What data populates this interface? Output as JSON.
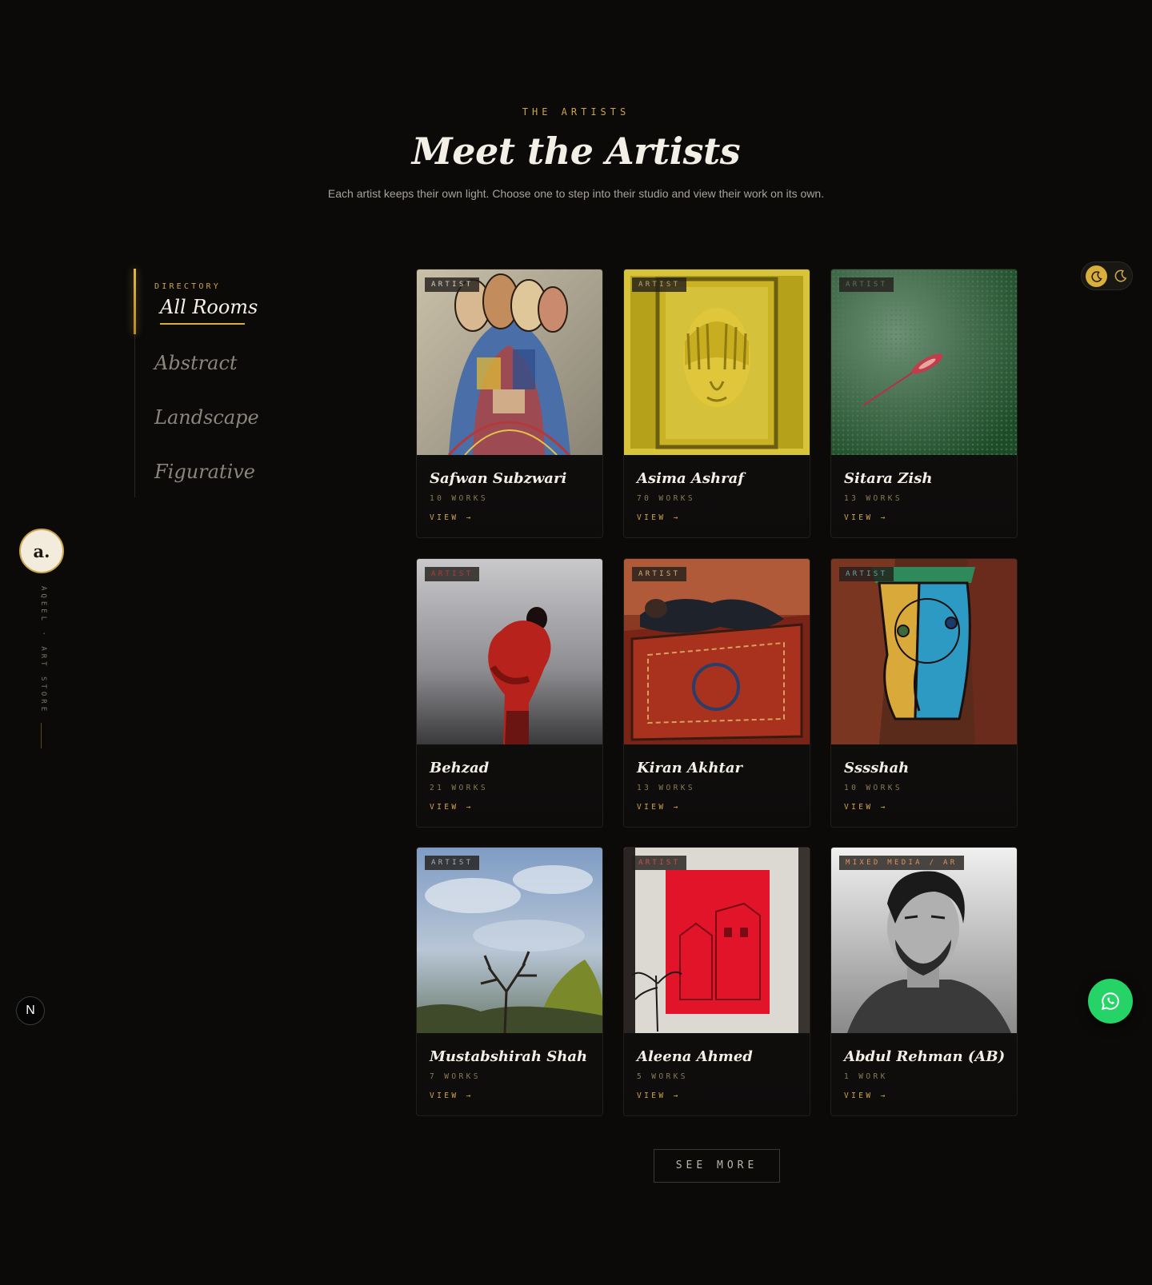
{
  "header": {
    "eyebrow": "THE ARTISTS",
    "title": "Meet the Artists",
    "subtitle": "Each artist keeps their own light. Choose one to step into their studio and view their work on its own."
  },
  "sidebar": {
    "label": "DIRECTORY",
    "items": [
      {
        "label": "All Rooms",
        "active": true
      },
      {
        "label": "Abstract",
        "active": false
      },
      {
        "label": "Landscape",
        "active": false
      },
      {
        "label": "Figurative",
        "active": false
      }
    ]
  },
  "artists": [
    {
      "badge": "ARTIST",
      "badge_color": "#d8cfbf",
      "name": "Safwan Subzwari",
      "works": "10 WORKS",
      "view": "VIEW →"
    },
    {
      "badge": "ARTIST",
      "badge_color": "#b9a873",
      "name": "Asima Ashraf",
      "works": "70 WORKS",
      "view": "VIEW →"
    },
    {
      "badge": "ARTIST",
      "badge_color": "#5f6e60",
      "name": "Sitara Zish",
      "works": "13 WORKS",
      "view": "VIEW →"
    },
    {
      "badge": "ARTIST",
      "badge_color": "#b03a3a",
      "name": "Behzad",
      "works": "21 WORKS",
      "view": "VIEW →"
    },
    {
      "badge": "ARTIST",
      "badge_color": "#d4b07a",
      "name": "Kiran Akhtar",
      "works": "13 WORKS",
      "view": "VIEW →"
    },
    {
      "badge": "ARTIST",
      "badge_color": "#6e9ea6",
      "name": "Sssshah",
      "works": "10 WORKS",
      "view": "VIEW →"
    },
    {
      "badge": "ARTIST",
      "badge_color": "#9fb1c4",
      "name": "Mustabshirah Shah",
      "works": "7 WORKS",
      "view": "VIEW →"
    },
    {
      "badge": "ARTIST",
      "badge_color": "#d24a4a",
      "name": "Aleena Ahmed",
      "works": "5 WORKS",
      "view": "VIEW →"
    },
    {
      "badge": "MIXED MEDIA / AR",
      "badge_color": "#e0905a",
      "name": "Abdul Rehman (AB)",
      "works": "1 WORK",
      "view": "VIEW →"
    }
  ],
  "see_more": "SEE MORE",
  "brand": {
    "logo": "a.",
    "vertical": "AQEEL · ART STORE"
  },
  "corner_badge": "N",
  "icons": {
    "theme_active": "moon-icon",
    "theme_alt": "moon-icon",
    "chat": "whatsapp-icon"
  },
  "colors": {
    "background": "#0b0a09",
    "accent": "#c9a54c",
    "whatsapp": "#25d366"
  }
}
